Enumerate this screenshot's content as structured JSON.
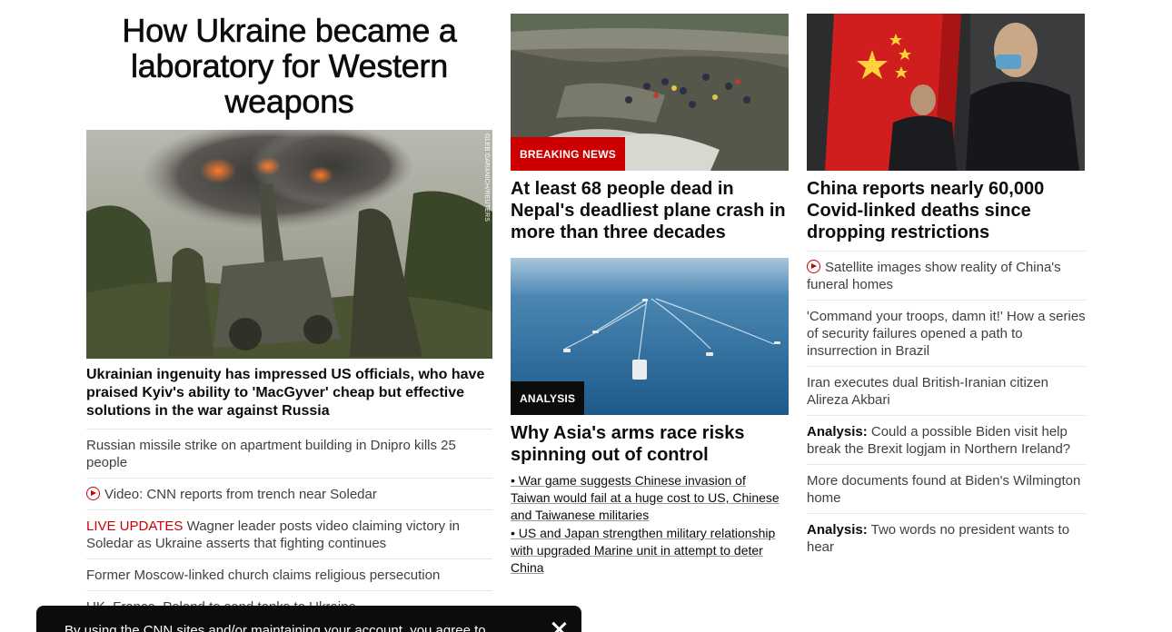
{
  "hero": {
    "title": "How Ukraine became a laboratory for Western weapons",
    "image_alt": "howitzer-firing-photo",
    "credit": "GLEB GARANICH/REUTERS",
    "lead": "Ukrainian ingenuity has impressed US officials, who have praised Kyiv's ability to 'MacGyver' cheap but effective solutions in the war against Russia"
  },
  "left_list": [
    {
      "text": "Russian missile strike on apartment building in Dnipro kills 25 people"
    },
    {
      "prefix": "",
      "text": "Video: CNN reports from trench near Soledar",
      "video": true
    },
    {
      "live": "LIVE UPDATES",
      "text": "Wagner leader posts video claiming victory in Soledar as Ukraine asserts that fighting continues"
    },
    {
      "text": "Former Moscow-linked church claims religious persecution"
    },
    {
      "text": "UK, France, Poland to send tanks to Ukraine"
    }
  ],
  "mid": {
    "card1": {
      "badge": "BREAKING NEWS",
      "title": "At least 68 people dead in Nepal's deadliest plane crash in more than three decades"
    },
    "card2": {
      "badge": "ANALYSIS",
      "title": "Why Asia's arms race risks spinning out of control",
      "bullets": [
        "• War game suggests Chinese invasion of Taiwan would fail at a huge cost to US, Chinese and Taiwanese militaries",
        "• US and Japan strengthen military relationship with upgraded Marine unit in attempt to deter China"
      ]
    }
  },
  "right": {
    "title": "China reports nearly 60,000 Covid-linked deaths since dropping restrictions",
    "list": [
      {
        "text": "Satellite images show reality of China's funeral homes",
        "video": true
      },
      {
        "text": "'Command your troops, damn it!' How a series of security failures opened a path to insurrection in Brazil"
      },
      {
        "text": "Iran executes dual British-Iranian citizen Alireza Akbari"
      },
      {
        "bold": "Analysis:",
        "text": "Could a possible Biden visit help break the Brexit logjam in Northern Ireland?"
      },
      {
        "text": "More documents found at Biden's Wilmington home"
      },
      {
        "bold": "Analysis:",
        "text": "Two words no president wants to hear"
      }
    ]
  },
  "consent": {
    "text": "By using the CNN sites and/or maintaining your account, you agree to"
  },
  "colors": {
    "accent": "#cc0000",
    "text": "#0c0c0c"
  }
}
